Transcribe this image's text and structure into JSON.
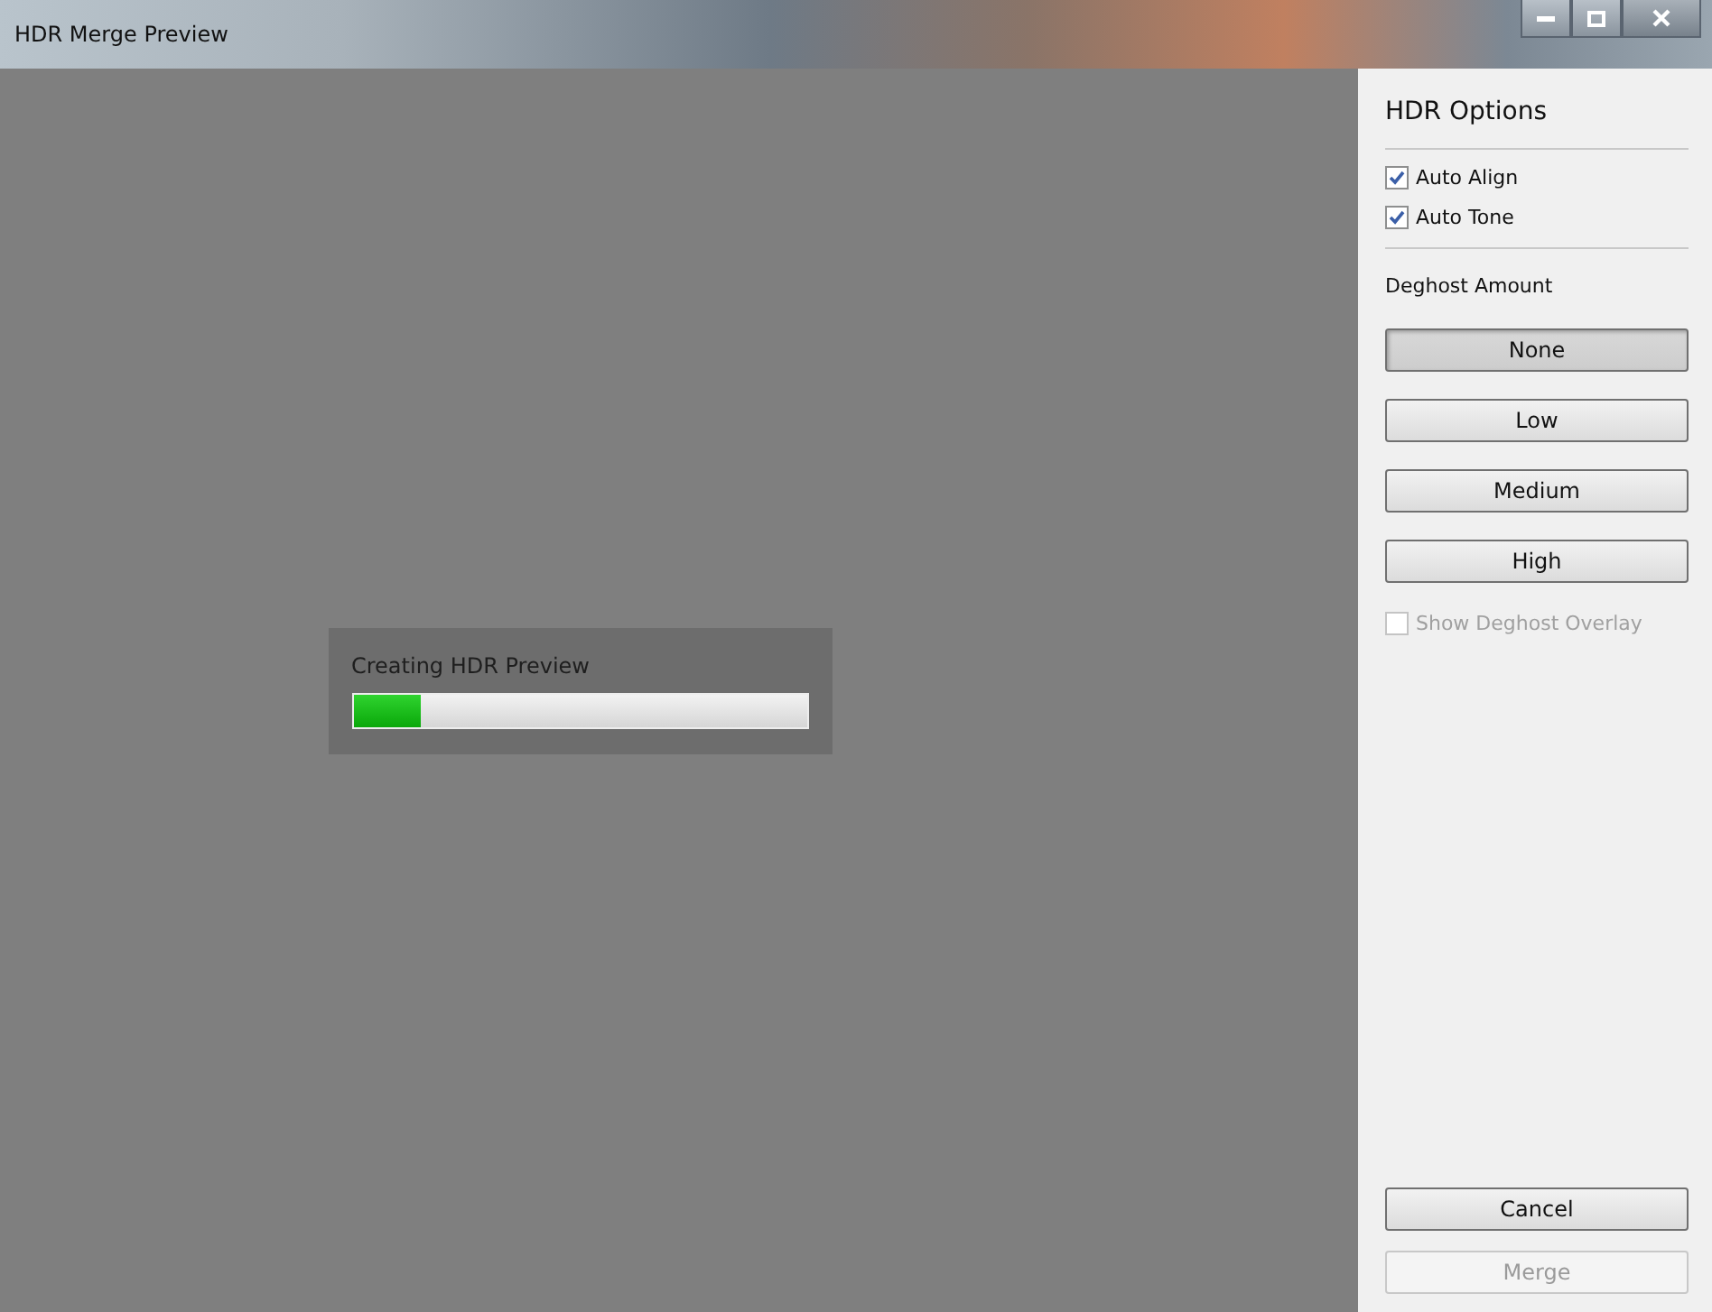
{
  "window": {
    "title": "HDR Merge Preview"
  },
  "progress": {
    "label": "Creating HDR Preview",
    "level": 0.15
  },
  "options": {
    "title": "HDR Options",
    "checkboxes": [
      {
        "label": "Auto Align",
        "checked": true,
        "disabled": false
      },
      {
        "label": "Auto Tone",
        "checked": true,
        "disabled": false
      }
    ],
    "deghost_label": "Deghost Amount",
    "deghost": [
      {
        "label": "None",
        "selected": true
      },
      {
        "label": "Low",
        "selected": false
      },
      {
        "label": "Medium",
        "selected": false
      },
      {
        "label": "High",
        "selected": false
      }
    ],
    "overlay": {
      "label": "Show Deghost Overlay",
      "checked": false,
      "disabled": true
    }
  },
  "buttons": [
    {
      "label": "Cancel",
      "disabled": false
    },
    {
      "label": "Merge",
      "disabled": true
    }
  ]
}
